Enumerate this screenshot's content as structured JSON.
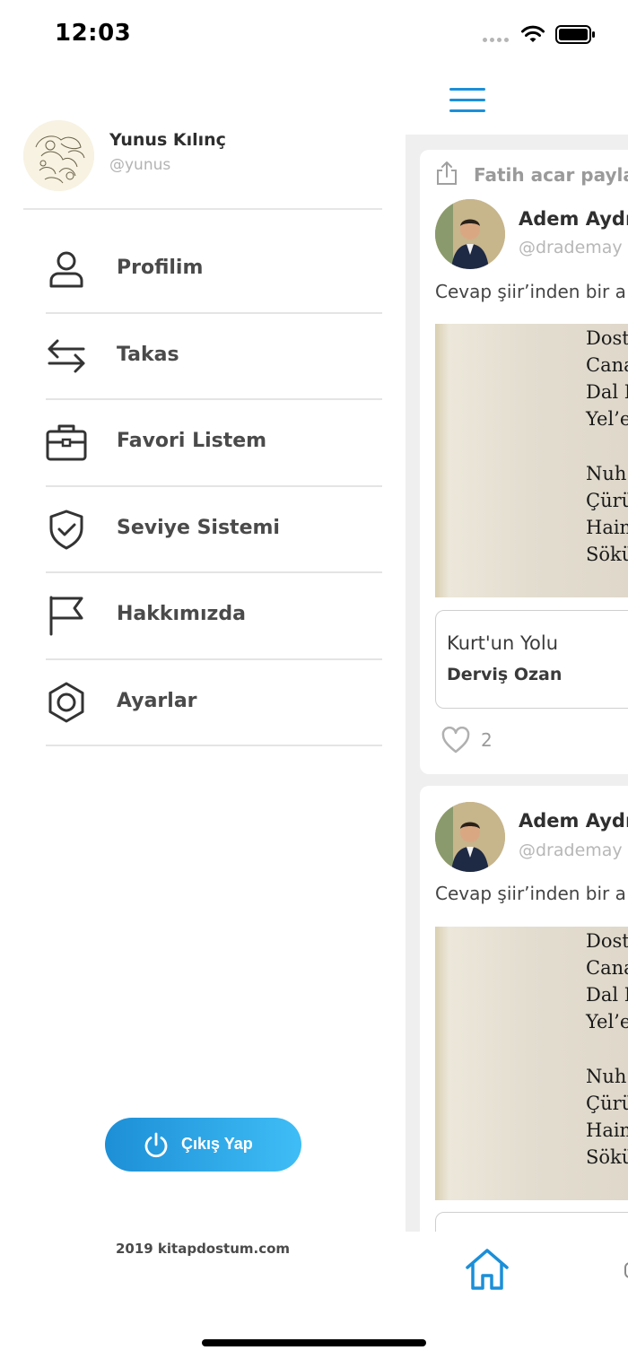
{
  "status_bar": {
    "time": "12:03"
  },
  "drawer": {
    "user": {
      "name": "Yunus Kılınç",
      "handle": "@yunus"
    },
    "menu": [
      {
        "label": "Profilim",
        "icon": "user-icon"
      },
      {
        "label": "Takas",
        "icon": "swap-arrows-icon"
      },
      {
        "label": "Favori Listem",
        "icon": "briefcase-icon"
      },
      {
        "label": "Seviye Sistemi",
        "icon": "shield-check-icon"
      },
      {
        "label": "Hakkımızda",
        "icon": "flag-icon"
      },
      {
        "label": "Ayarlar",
        "icon": "settings-hexagon-icon"
      }
    ],
    "logout_label": "Çıkış Yap",
    "footer": "2019 kitapdostum.com"
  },
  "feed": {
    "share_text": "Fatih acar payla",
    "posts": [
      {
        "author": "Adem Aydı",
        "handle": "@drademay",
        "text": "Cevap şiir’inden bir a",
        "page_lines": [
          "Dost",
          "Cana",
          "Dal I",
          "Yel’e",
          "Nuh’",
          "Çürü",
          "Hain",
          "Sökü"
        ],
        "book_title": "Kurt'un Yolu",
        "book_author": "Derviş Ozan",
        "likes": "2"
      },
      {
        "author": "Adem Aydı",
        "handle": "@drademay",
        "text": "Cevap şiir’inden bir a",
        "page_lines": [
          "Dost",
          "Cana",
          "Dal I",
          "Yel’e",
          "Nuh’",
          "Çürü",
          "Hain",
          "Sökü"
        ]
      }
    ]
  },
  "colors": {
    "accent": "#1b8fd8",
    "gradient_start": "#1d8fd6",
    "gradient_end": "#3fbdf6"
  }
}
